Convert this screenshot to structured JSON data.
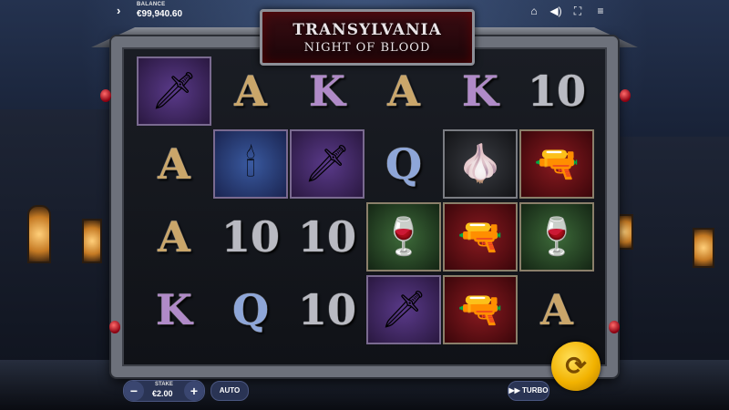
{
  "top_bar": {
    "balance_label": "BALANCE",
    "balance_value": "€99,940.60",
    "menu_arrow": "›",
    "icons": [
      "home-icon",
      "sound-icon",
      "fullscreen-icon",
      "hamburger-menu-icon"
    ]
  },
  "title": {
    "line1": "TRANSYLVANIA",
    "line2": "NIGHT OF BLOOD"
  },
  "reels": [
    [
      {
        "symbol": "dagger",
        "label": "",
        "bg": "purple"
      },
      {
        "symbol": "A",
        "bg": "none"
      },
      {
        "symbol": "A",
        "bg": "none"
      },
      {
        "symbol": "K",
        "bg": "none"
      }
    ],
    [
      {
        "symbol": "A",
        "bg": "none"
      },
      {
        "symbol": "candelabra",
        "bg": "blue"
      },
      {
        "symbol": "10",
        "bg": "none"
      },
      {
        "symbol": "Q",
        "bg": "none"
      }
    ],
    [
      {
        "symbol": "K",
        "bg": "none"
      },
      {
        "symbol": "dagger",
        "bg": "purple"
      },
      {
        "symbol": "10",
        "bg": "none"
      },
      {
        "symbol": "10",
        "bg": "none"
      }
    ],
    [
      {
        "symbol": "A",
        "bg": "none"
      },
      {
        "symbol": "Q",
        "bg": "none"
      },
      {
        "symbol": "wine",
        "bg": "green"
      },
      {
        "symbol": "dagger",
        "bg": "purple"
      }
    ],
    [
      {
        "symbol": "K",
        "bg": "none"
      },
      {
        "symbol": "garlic",
        "bg": "gray"
      },
      {
        "symbol": "revolver",
        "bg": "red"
      },
      {
        "symbol": "revolver",
        "bg": "red"
      }
    ],
    [
      {
        "symbol": "10",
        "bg": "none"
      },
      {
        "symbol": "revolver",
        "bg": "red"
      },
      {
        "symbol": "wine",
        "bg": "green"
      },
      {
        "symbol": "A",
        "bg": "none"
      }
    ]
  ],
  "controls": {
    "minus": "−",
    "plus": "+",
    "stake_label": "STAKE",
    "stake_value": "€2.00",
    "auto": "AUTO",
    "turbo": "TURBO",
    "turbo_icon": "fast-forward-icon",
    "spin_icon": "spin-arrows-icon"
  },
  "colors": {
    "spin_button": "#f2b200",
    "control_bg": "#2a3454",
    "title_bg": "#3a0c12"
  }
}
